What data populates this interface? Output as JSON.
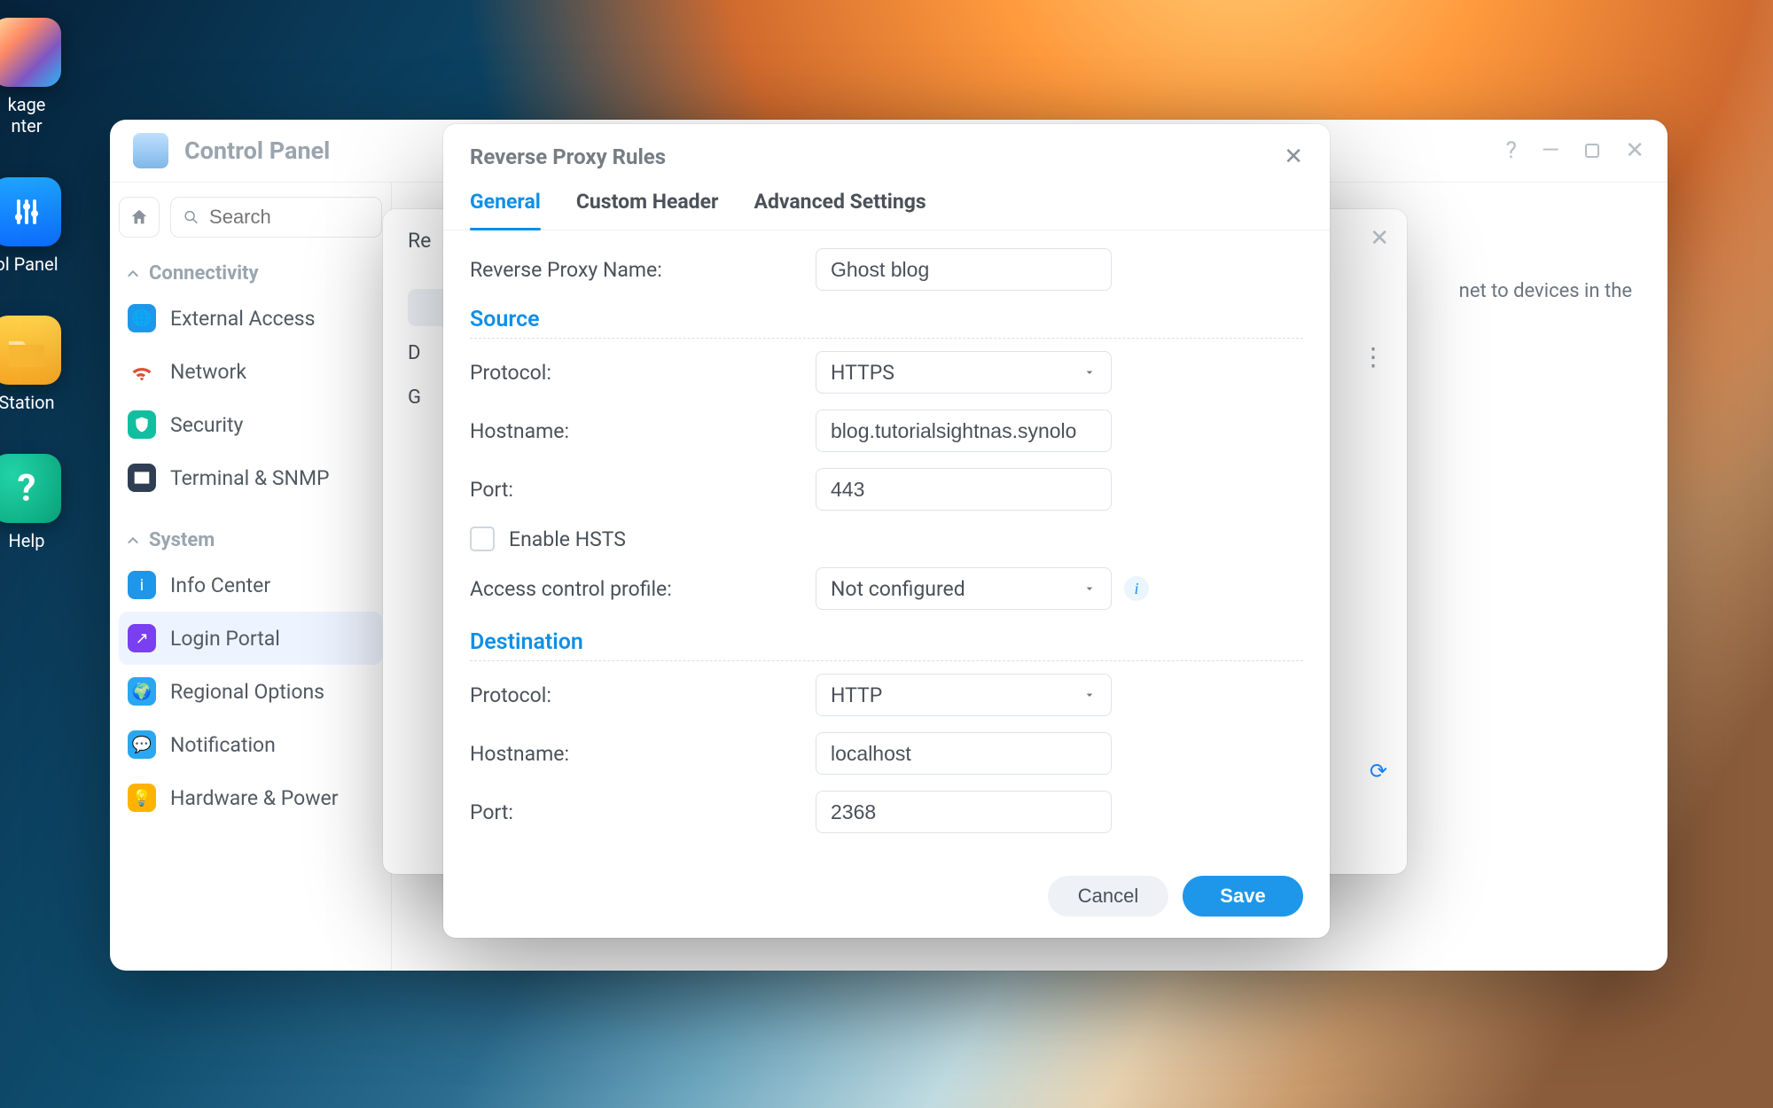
{
  "desktop_icons": {
    "pkg_label": "kage\nnter",
    "panel_label": "ol Panel",
    "files_label": "Station",
    "help_label": "Help"
  },
  "cp": {
    "title": "Control Panel",
    "search_placeholder": "Search",
    "groups": {
      "connectivity_header": "Connectivity",
      "system_header": "System"
    },
    "items": {
      "external_access": "External Access",
      "network": "Network",
      "security": "Security",
      "terminal": "Terminal & SNMP",
      "info_center": "Info Center",
      "login_portal": "Login Portal",
      "regional_options": "Regional Options",
      "notification": "Notification",
      "hardware_power": "Hardware & Power"
    },
    "main_help_fragment": "net to devices in the"
  },
  "bg_modal": {
    "title_fragment": "Re",
    "row_d": "D",
    "row_gb": "G"
  },
  "modal": {
    "title": "Reverse Proxy Rules",
    "tabs": {
      "general": "General",
      "custom_header": "Custom Header",
      "advanced": "Advanced Settings"
    },
    "labels": {
      "name": "Reverse Proxy Name:",
      "source_section": "Source",
      "dest_section": "Destination",
      "protocol": "Protocol:",
      "hostname": "Hostname:",
      "port": "Port:",
      "enable_hsts": "Enable HSTS",
      "access_profile": "Access control profile:"
    },
    "values": {
      "name": "Ghost blog",
      "src_protocol": "HTTPS",
      "src_hostname": "blog.tutorialsightnas.synolo",
      "src_port": "443",
      "access_profile": "Not configured",
      "dst_protocol": "HTTP",
      "dst_hostname": "localhost",
      "dst_port": "2368",
      "enable_hsts_checked": false
    },
    "footer": {
      "cancel": "Cancel",
      "save": "Save"
    }
  }
}
